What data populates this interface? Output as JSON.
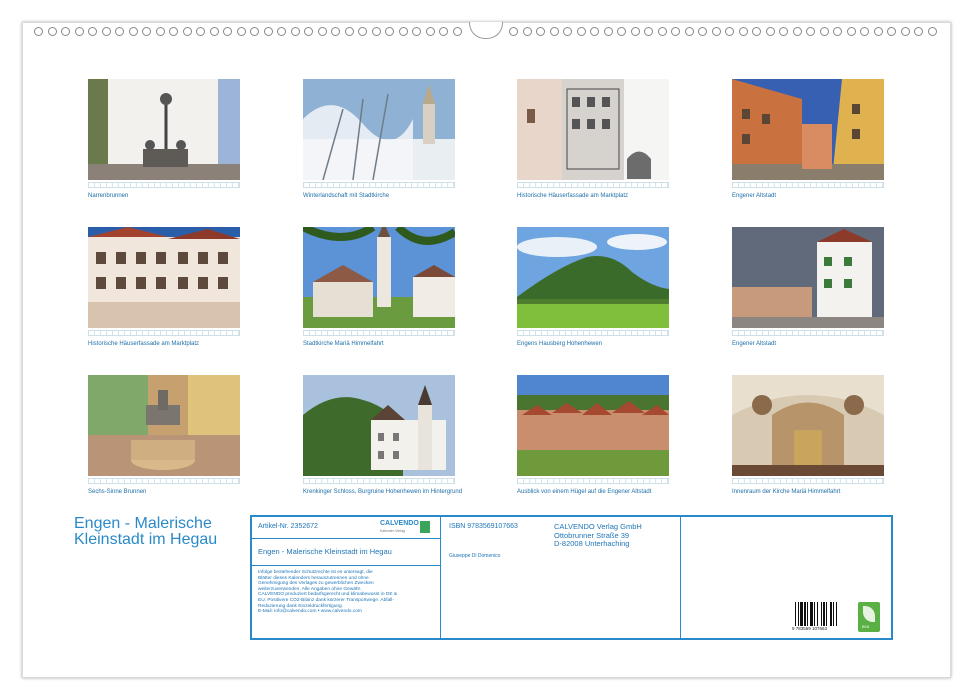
{
  "calendar_title": [
    "Engen - Malerische",
    "Kleinstadt im Hegau"
  ],
  "photos": [
    {
      "caption": "Narrenbrunnen",
      "icon": "fountain-statue-photo"
    },
    {
      "caption": "Winterlandschaft mit Stadtkirche",
      "icon": "winter-church-photo"
    },
    {
      "caption": "Historische Häuserfassade am Marktplatz",
      "icon": "facade-photo"
    },
    {
      "caption": "Engener Altstadt",
      "icon": "old-town-street-photo"
    },
    {
      "caption": "Historische Häuserfassade am Marktplatz",
      "icon": "facade-photo"
    },
    {
      "caption": "Stadtkirche Mariä Himmelfahrt",
      "icon": "church-photo"
    },
    {
      "caption": "Engens Hausberg Hohenhewen",
      "icon": "mountain-photo"
    },
    {
      "caption": "Engener Altstadt",
      "icon": "old-town-street-photo"
    },
    {
      "caption": "Sechs-Sinne Brunnen",
      "icon": "fountain-square-photo"
    },
    {
      "caption": "Krenkinger Schloss, Burgruine Hohenhewen im Hintergrund",
      "icon": "castle-photo"
    },
    {
      "caption": "Ausblick von einem Hügel auf die Engener Altstadt",
      "icon": "town-view-photo"
    },
    {
      "caption": "Innenraum der Kirche Mariä Himmelfahrt",
      "icon": "church-interior-photo"
    }
  ],
  "info": {
    "article": "Artikel-Nr. 2352672",
    "brand": "CALVENDO",
    "brand_sub": "Kalender-Verlag",
    "calendar_name": "Engen - Malerische Kleinstadt im Hegau",
    "isbn": "ISBN 9783569107663",
    "author": "Giuseppe Di Domenico",
    "publisher": [
      "CALVENDO Verlag GmbH",
      "Ottobrunner Straße 39",
      "D-82008 Unterhaching"
    ],
    "legal": [
      "Infolge bestehender Schutzrechte ist es untersagt, die",
      "Blätter dieses Kalenders herauszutrennen und ohne",
      "Genehmigung des Verlages zu gewerblichen Zwecken",
      "weiterzuverwenden. Alle Angaben ohne Gewähr.",
      "CALVENDO produziert bedarfsgerecht und klimabewusst in DE &",
      "EU. Positivere CO2-Bilanz dank kürzerer Transportwege. Abfall-",
      "Reduzierung dank Einzeldruckfertigung.",
      "E-Mail: info@calvendo.com • www.calvendo.com"
    ],
    "barcode_number": "9 783569 107663",
    "eco_label": "eco"
  }
}
